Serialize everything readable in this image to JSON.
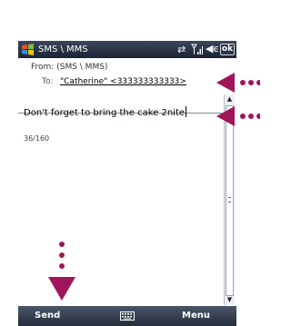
{
  "colors": {
    "arrow_accent": "#a0155a",
    "titlebar_bg": "#1c2433",
    "softkey_bg": "#323a4a"
  },
  "titlebar": {
    "app_title": "SMS \\ MMS",
    "ok_label": "ok",
    "icons": [
      "windows-start-icon",
      "sync-icon",
      "signal-icon",
      "volume-icon"
    ]
  },
  "header": {
    "from_label": "From:",
    "from_value": "(SMS \\ MMS)",
    "to_label": "To:",
    "to_value": "\"Catherine\" <333333333333>"
  },
  "message": {
    "body": "Don't forget to bring the cake 2nite",
    "char_count": "36/160"
  },
  "softkeys": {
    "left": "Send",
    "right": "Menu",
    "center_icon": "keyboard-icon"
  }
}
